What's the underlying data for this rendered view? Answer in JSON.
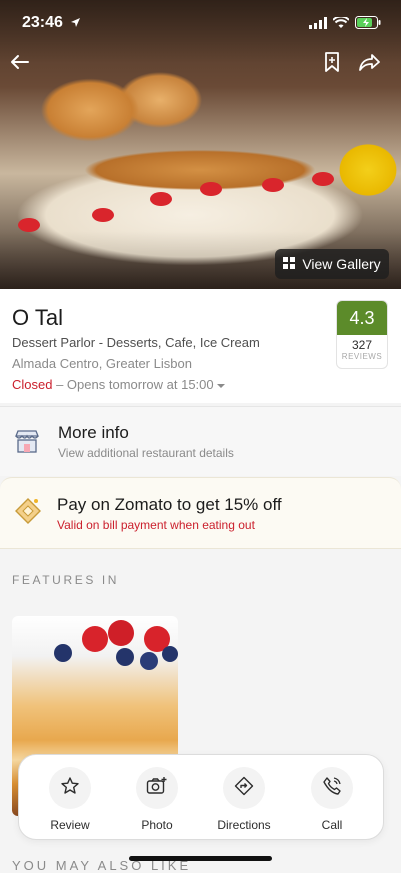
{
  "status_bar": {
    "time": "23:46"
  },
  "restaurant": {
    "name": "O Tal",
    "type": "Dessert Parlor - Desserts, Cafe, Ice Cream",
    "location": "Almada Centro, Greater Lisbon",
    "status_closed": "Closed",
    "status_opens": "– Opens tomorrow at 15:00",
    "rating": "4.3",
    "review_count": "327",
    "review_label": "REVIEWS"
  },
  "gallery": {
    "label": "View Gallery"
  },
  "more_info": {
    "title": "More info",
    "subtitle": "View additional restaurant details"
  },
  "promo": {
    "title": "Pay on Zomato to get 15% off",
    "subtitle": "Valid on bill payment when eating out"
  },
  "features": {
    "header": "FEATURES IN"
  },
  "you_may_also_like": "YOU MAY ALSO LIKE",
  "actions": [
    {
      "label": "Review",
      "icon": "star-icon"
    },
    {
      "label": "Photo",
      "icon": "camera-icon"
    },
    {
      "label": "Directions",
      "icon": "directions-icon"
    },
    {
      "label": "Call",
      "icon": "phone-icon"
    }
  ],
  "colors": {
    "rating_green": "#5c8b2a",
    "closed_red": "#cb202d",
    "promo_red": "#cb202d"
  }
}
